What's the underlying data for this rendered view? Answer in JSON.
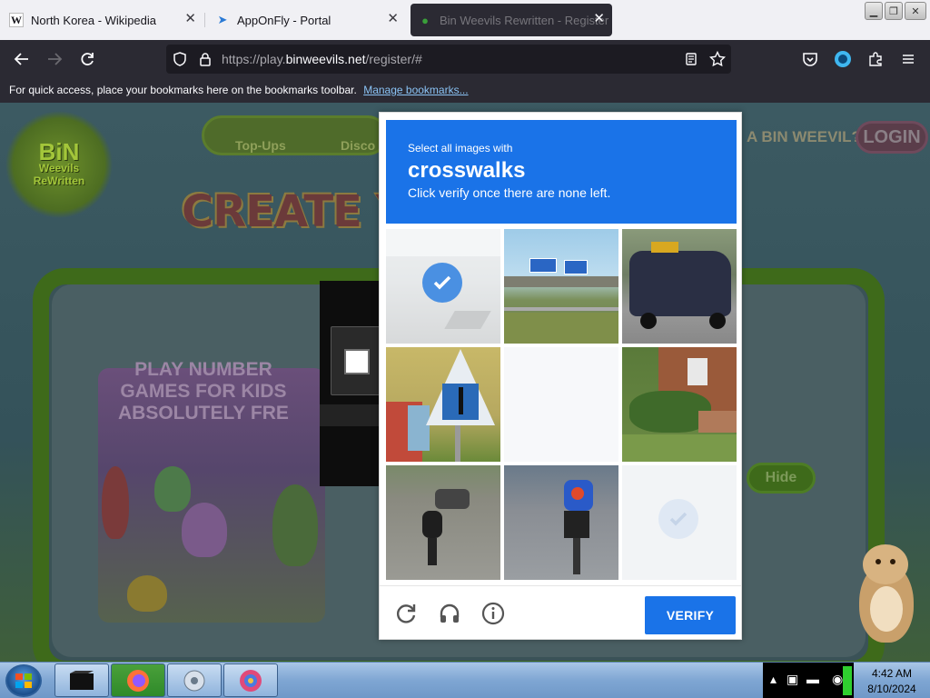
{
  "browser": {
    "tabs": [
      {
        "title": "North Korea - Wikipedia",
        "favicon": "wikipedia-icon",
        "active": false
      },
      {
        "title": "AppOnFly - Portal",
        "favicon": "paper-plane-icon",
        "active": false
      },
      {
        "title": "Bin Weevils Rewritten - Register",
        "favicon": "bin-weevils-icon",
        "active": true
      }
    ],
    "url": {
      "prefix": "https://play.",
      "domain": "binweevils.net",
      "suffix": "/register/#"
    },
    "bookmarks_bar": {
      "message": "For quick access, place your bookmarks here on the bookmarks toolbar.",
      "link": "Manage bookmarks..."
    },
    "colors": {
      "chrome_dark": "#2b2a33",
      "tabstrip": "#f0f0f4",
      "link": "#8ac3f5"
    }
  },
  "page": {
    "logo": {
      "line1": "BiN",
      "line2": "Weevils",
      "line3": "ReWritten"
    },
    "nav": {
      "topups": "Top-Ups",
      "discord": "Disco"
    },
    "title": "CREATE Y",
    "question": "A BIN WEEVIL?",
    "login": "LOGIN",
    "game_card": {
      "line1": "PLAY NUMBER",
      "line2": "GAMES FOR KIDS",
      "line3": "ABSOLUTELY FRE"
    },
    "hide_button": "Hide"
  },
  "captcha": {
    "instruction": "Select all images with",
    "target": "crosswalks",
    "hint": "Click verify once there are none left.",
    "verify_label": "VERIFY",
    "accent": "#1a73e8",
    "tiles": [
      {
        "subject": "street-corner",
        "selected": true
      },
      {
        "subject": "highway-overpass",
        "selected": false
      },
      {
        "subject": "taxi-car",
        "selected": false
      },
      {
        "subject": "pedestrian-crossing-sign",
        "selected": false
      },
      {
        "subject": "blank-loading",
        "selected": false
      },
      {
        "subject": "house-with-bushes",
        "selected": false
      },
      {
        "subject": "motorcycle-road",
        "selected": false
      },
      {
        "subject": "cyclist-road",
        "selected": false
      },
      {
        "subject": "fading-tile",
        "selected": true
      }
    ]
  },
  "taskbar": {
    "time": "4:42 AM",
    "date": "8/10/2024",
    "apps": [
      "terminal-icon",
      "firefox-icon",
      "media-icon",
      "browser-swirl-icon"
    ]
  }
}
